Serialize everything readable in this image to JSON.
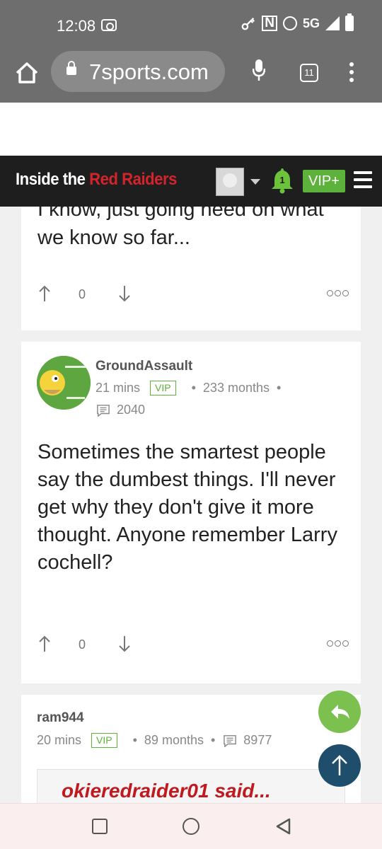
{
  "status_bar": {
    "time": "12:08",
    "network": "5G"
  },
  "browser": {
    "url": "7sports.com",
    "tab_count": "11"
  },
  "site_header": {
    "logo_prefix": "Inside the ",
    "logo_accent": "Red Raiders",
    "notification_count": "1",
    "vip_label": "VIP+"
  },
  "posts": [
    {
      "body": "I know, just going need on what we know so far...",
      "votes": "0"
    },
    {
      "author": "GroundAssault",
      "time": "21 mins",
      "badge": "VIP",
      "tenure": "233 months",
      "post_count": "2040",
      "body": "Sometimes the smartest people say the dumbest things. I'll never get why they don't give it more thought. Anyone remember Larry cochell?",
      "votes": "0"
    },
    {
      "author": "ram944",
      "time": "20 mins",
      "badge": "VIP",
      "tenure": "89 months",
      "post_count": "8977",
      "quote_title": "okieredraider01 said..."
    }
  ],
  "colors": {
    "chrome_gray": "#6e6e6e",
    "header_black": "#1e1e1e",
    "brand_red": "#d4242b",
    "vip_green": "#5cb23a",
    "fab_navy": "#1f4e6d"
  }
}
